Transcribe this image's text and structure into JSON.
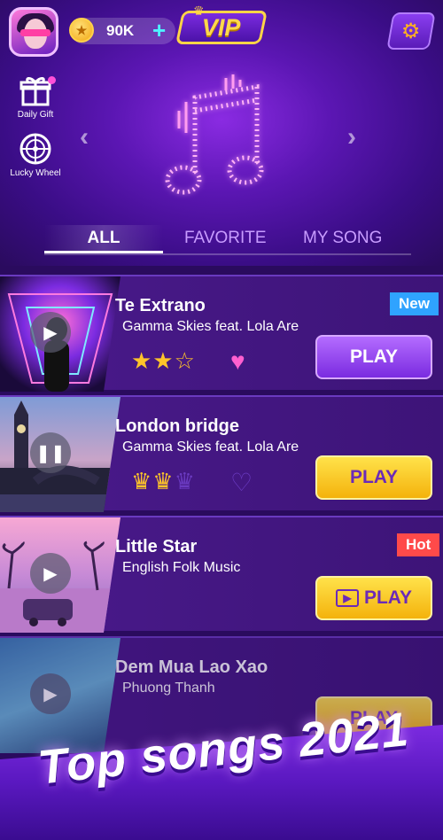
{
  "header": {
    "coins": "90K",
    "coin_plus": "+",
    "vip_label": "VIP"
  },
  "side": {
    "daily_gift": "Daily Gift",
    "lucky_wheel": "Lucky Wheel"
  },
  "tabs": [
    {
      "label": "ALL",
      "active": true
    },
    {
      "label": "FAVORITE",
      "active": false
    },
    {
      "label": "MY SONG",
      "active": false
    }
  ],
  "songs": [
    {
      "title": "Te Extrano",
      "artist": "Gamma Skies feat. Lola Are",
      "stars": 2,
      "star_max": 3,
      "rating_icon": "star",
      "favorited": true,
      "badge": "New",
      "button": "PLAY",
      "button_style": "purple",
      "state": "play"
    },
    {
      "title": "London bridge",
      "artist": "Gamma Skies feat. Lola Are",
      "stars": 2,
      "star_max": 3,
      "rating_icon": "crown",
      "favorited": false,
      "badge": "",
      "button": "PLAY",
      "button_style": "yellow",
      "state": "pause"
    },
    {
      "title": "Little Star",
      "artist": "English Folk Music",
      "stars": 0,
      "star_max": 0,
      "rating_icon": "none",
      "favorited": false,
      "badge": "Hot",
      "button": "PLAY",
      "button_style": "yellow-video",
      "state": "play"
    },
    {
      "title": "Dem Mua Lao Xao",
      "artist": "Phuong Thanh",
      "stars": 0,
      "star_max": 0,
      "rating_icon": "none",
      "favorited": false,
      "badge": "",
      "button": "PLAY",
      "button_style": "yellow",
      "state": "play"
    }
  ],
  "banner": {
    "text": "Top songs 2021"
  },
  "colors": {
    "accent_purple": "#7a2be0",
    "accent_yellow": "#f4b20c",
    "new_badge": "#2fa3ff",
    "hot_badge": "#ff4a4a"
  }
}
